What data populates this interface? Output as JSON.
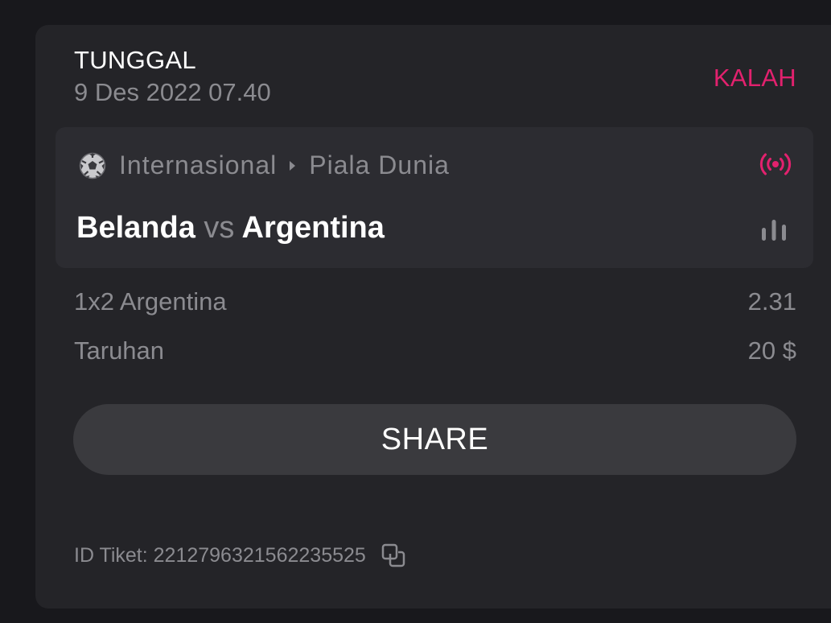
{
  "bet": {
    "type": "TUNGGAL",
    "date": "9 Des 2022 07.40",
    "status": "KALAH",
    "status_color": "#e2216e"
  },
  "event": {
    "sport_icon": "soccer-ball-icon",
    "category": "Internasional",
    "league": "Piala Dunia",
    "live_icon": "live-broadcast-icon",
    "home_team": "Belanda",
    "vs": "vs",
    "away_team": "Argentina",
    "stats_icon": "stats-bars-icon"
  },
  "selection": {
    "label": "1x2 Argentina",
    "odds": "2.31"
  },
  "stake": {
    "label": "Taruhan",
    "value": "20 $"
  },
  "share_label": "SHARE",
  "ticket": {
    "text": "ID Tiket: 2212796321562235525",
    "copy_icon": "copy-icon"
  }
}
